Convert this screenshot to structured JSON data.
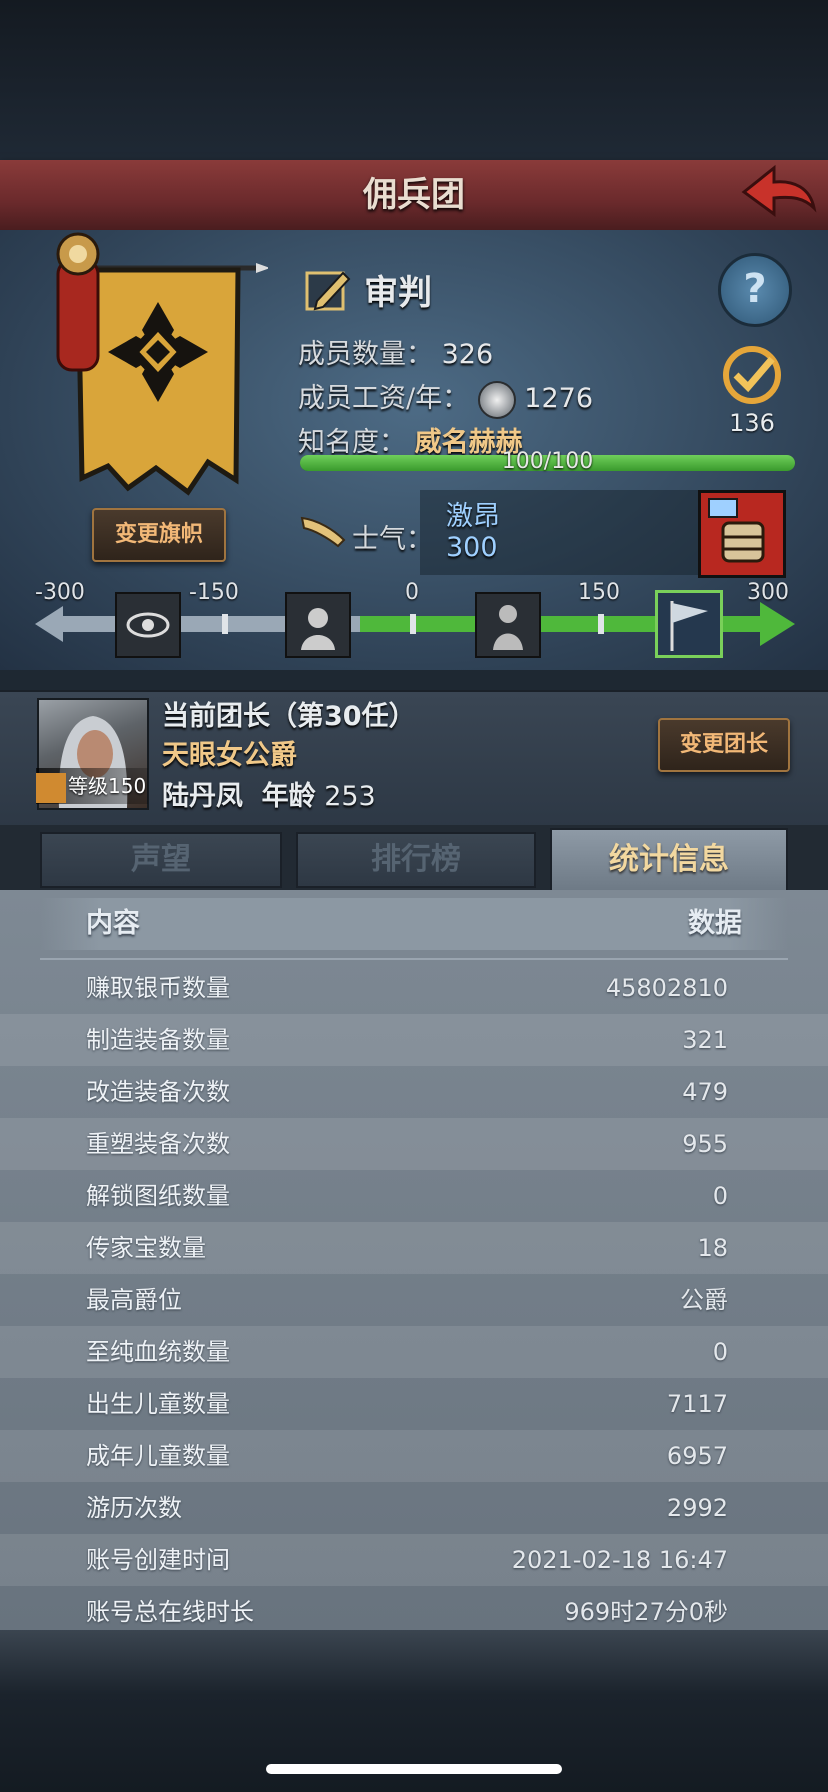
{
  "header": {
    "title": "佣兵团"
  },
  "guild": {
    "name": "审判",
    "member_count_label": "成员数量：",
    "member_count": "326",
    "salary_label": "成员工资/年：",
    "salary": "1276",
    "fame_label": "知名度：",
    "fame_value": "威名赫赫",
    "fame_progress": "100/100",
    "fame_fraction": 1.0,
    "change_banner_button": "变更旗帜",
    "badge_count": "136",
    "morale_label": "士气：",
    "morale_status": "激昂",
    "morale_value": "300"
  },
  "morale_scale": {
    "ticks": [
      "-300",
      "-150",
      "0",
      "150",
      "300"
    ],
    "icons": [
      "eye-icon",
      "despair-icon",
      "calm-icon",
      "rally-flag-icon"
    ],
    "active_icon": "rally-flag-icon",
    "value": 300
  },
  "captain": {
    "title": "当前团长（第30任）",
    "rank": "天眼女公爵",
    "level_label": "等级150",
    "name": "陆丹凤",
    "age_label": "年龄",
    "age": "253",
    "change_button": "变更团长"
  },
  "tabs": [
    {
      "label": "声望",
      "active": false
    },
    {
      "label": "排行榜",
      "active": false
    },
    {
      "label": "统计信息",
      "active": true
    }
  ],
  "table": {
    "header_left": "内容",
    "header_right": "数据",
    "rows": [
      {
        "label": "赚取银币数量",
        "value": "45802810"
      },
      {
        "label": "制造装备数量",
        "value": "321"
      },
      {
        "label": "改造装备次数",
        "value": "479"
      },
      {
        "label": "重塑装备次数",
        "value": "955"
      },
      {
        "label": "解锁图纸数量",
        "value": "0"
      },
      {
        "label": "传家宝数量",
        "value": "18"
      },
      {
        "label": "最高爵位",
        "value": "公爵"
      },
      {
        "label": "至纯血统数量",
        "value": "0"
      },
      {
        "label": "出生儿童数量",
        "value": "7117"
      },
      {
        "label": "成年儿童数量",
        "value": "6957"
      },
      {
        "label": "游历次数",
        "value": "2992"
      },
      {
        "label": "账号创建时间",
        "value": "2021-02-18 16:47"
      },
      {
        "label": "账号总在线时长",
        "value": "969时27分0秒"
      }
    ]
  },
  "colors": {
    "title_bar": "#7a3232",
    "accent_gold": "#f0c888",
    "progress_green": "#4fb83b",
    "morale_blue": "#9fd0ff"
  }
}
